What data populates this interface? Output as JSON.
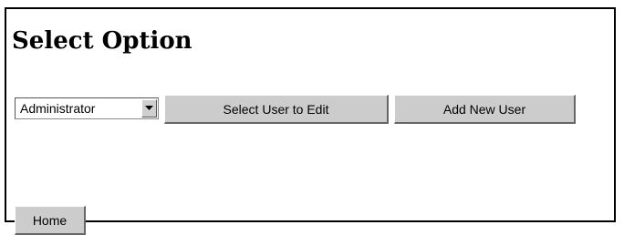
{
  "page": {
    "title": "Select Option"
  },
  "form": {
    "user_select": {
      "selected": "Administrator",
      "icon": "chevron-down-icon"
    },
    "select_user_button": "Select User to Edit",
    "add_user_button": "Add New User"
  },
  "nav": {
    "home_button": "Home"
  }
}
